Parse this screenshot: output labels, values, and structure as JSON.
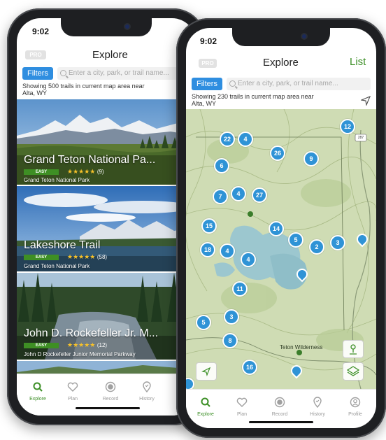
{
  "phone_left": {
    "time": "9:02",
    "pro_badge": "PRO",
    "title": "Explore",
    "filters_label": "Filters",
    "search_placeholder": "Enter a city, park, or trail name...",
    "count_line1": "Showing 500 trails in current map area near",
    "count_line2": "Alta, WY",
    "trails": [
      {
        "name": "Grand Teton National Pa...",
        "difficulty": "EASY",
        "stars": "★★★★★",
        "reviews": "(9)",
        "park": "Grand Teton National Park"
      },
      {
        "name": "Lakeshore Trail",
        "difficulty": "EASY",
        "stars": "★★★★★",
        "reviews": "(58)",
        "park": "Grand Teton National Park"
      },
      {
        "name": "John D. Rockefeller Jr. M...",
        "difficulty": "EASY",
        "stars": "★★★★★",
        "reviews": "(12)",
        "park": "John D Rockefeller Junior Memorial Parkway"
      }
    ],
    "tabs": [
      "Explore",
      "Plan",
      "Record",
      "History"
    ]
  },
  "phone_right": {
    "time": "9:02",
    "pro_badge": "PRO",
    "title": "Explore",
    "list_label": "List",
    "filters_label": "Filters",
    "search_placeholder": "Enter a city, park, or trail name...",
    "count_line1": "Showing 230 trails in current map area near",
    "count_line2": "Alta, WY",
    "clusters": [
      "12",
      "22",
      "4",
      "26",
      "9",
      "6",
      "7",
      "4",
      "27",
      "15",
      "14",
      "5",
      "2",
      "3",
      "18",
      "4",
      "4",
      "11",
      "3",
      "5",
      "8",
      "16"
    ],
    "map_label": "Teton Wilderness",
    "road_shield": "287",
    "tabs": [
      "Explore",
      "Plan",
      "Record",
      "History",
      "Profile"
    ]
  },
  "colors": {
    "accent_green": "#3c8f26",
    "accent_blue": "#2f8ee0",
    "cluster_blue": "#2f93d6",
    "star": "#f6c12a"
  }
}
